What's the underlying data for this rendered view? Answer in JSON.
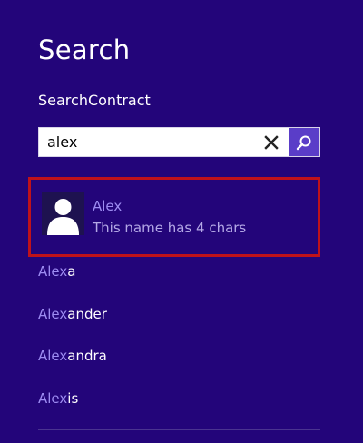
{
  "pane": {
    "title": "Search",
    "app_name": "SearchContract"
  },
  "search": {
    "value": "alex",
    "clear_icon": "close-icon",
    "search_icon": "search-icon"
  },
  "result": {
    "name": "Alex",
    "description": "This name has 4 chars",
    "icon": "person-icon"
  },
  "suggestions": [
    {
      "match": "Alex",
      "rest": "a"
    },
    {
      "match": "Alex",
      "rest": "ander"
    },
    {
      "match": "Alex",
      "rest": "andra"
    },
    {
      "match": "Alex",
      "rest": "is"
    }
  ],
  "colors": {
    "background": "#23057a",
    "accent": "#5a3dc8",
    "highlight_text": "#9d8cf2",
    "selection_border": "#c0121a"
  }
}
